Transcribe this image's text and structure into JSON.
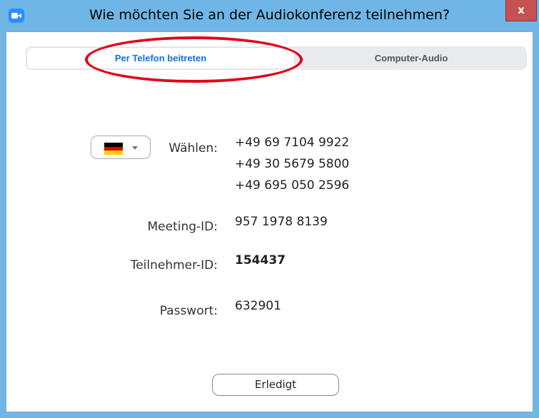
{
  "window": {
    "title": "Wie möchten Sie an der Audiokonferenz teilnehmen?",
    "close_label": "x",
    "app_icon": "zoom-camera-icon"
  },
  "tabs": [
    {
      "label": "Per Telefon beitreten",
      "active": true
    },
    {
      "label": "Computer-Audio",
      "active": false
    }
  ],
  "dial": {
    "country_flag": "de-flag-icon",
    "label": "Wählen:",
    "numbers": [
      "+49 69 7104 9922",
      "+49 30 5679 5800",
      "+49 695 050 2596"
    ]
  },
  "meeting": {
    "id_label": "Meeting-ID:",
    "id_value": "957 1978 8139",
    "participant_label": "Teilnehmer-ID:",
    "participant_value": "154437",
    "password_label": "Passwort:",
    "password_value": "632901"
  },
  "actions": {
    "done_label": "Erledigt"
  },
  "colors": {
    "titlebar": "#6fb6e6",
    "accent": "#0e71eb",
    "highlight": "#e2001a",
    "close": "#c75050"
  }
}
